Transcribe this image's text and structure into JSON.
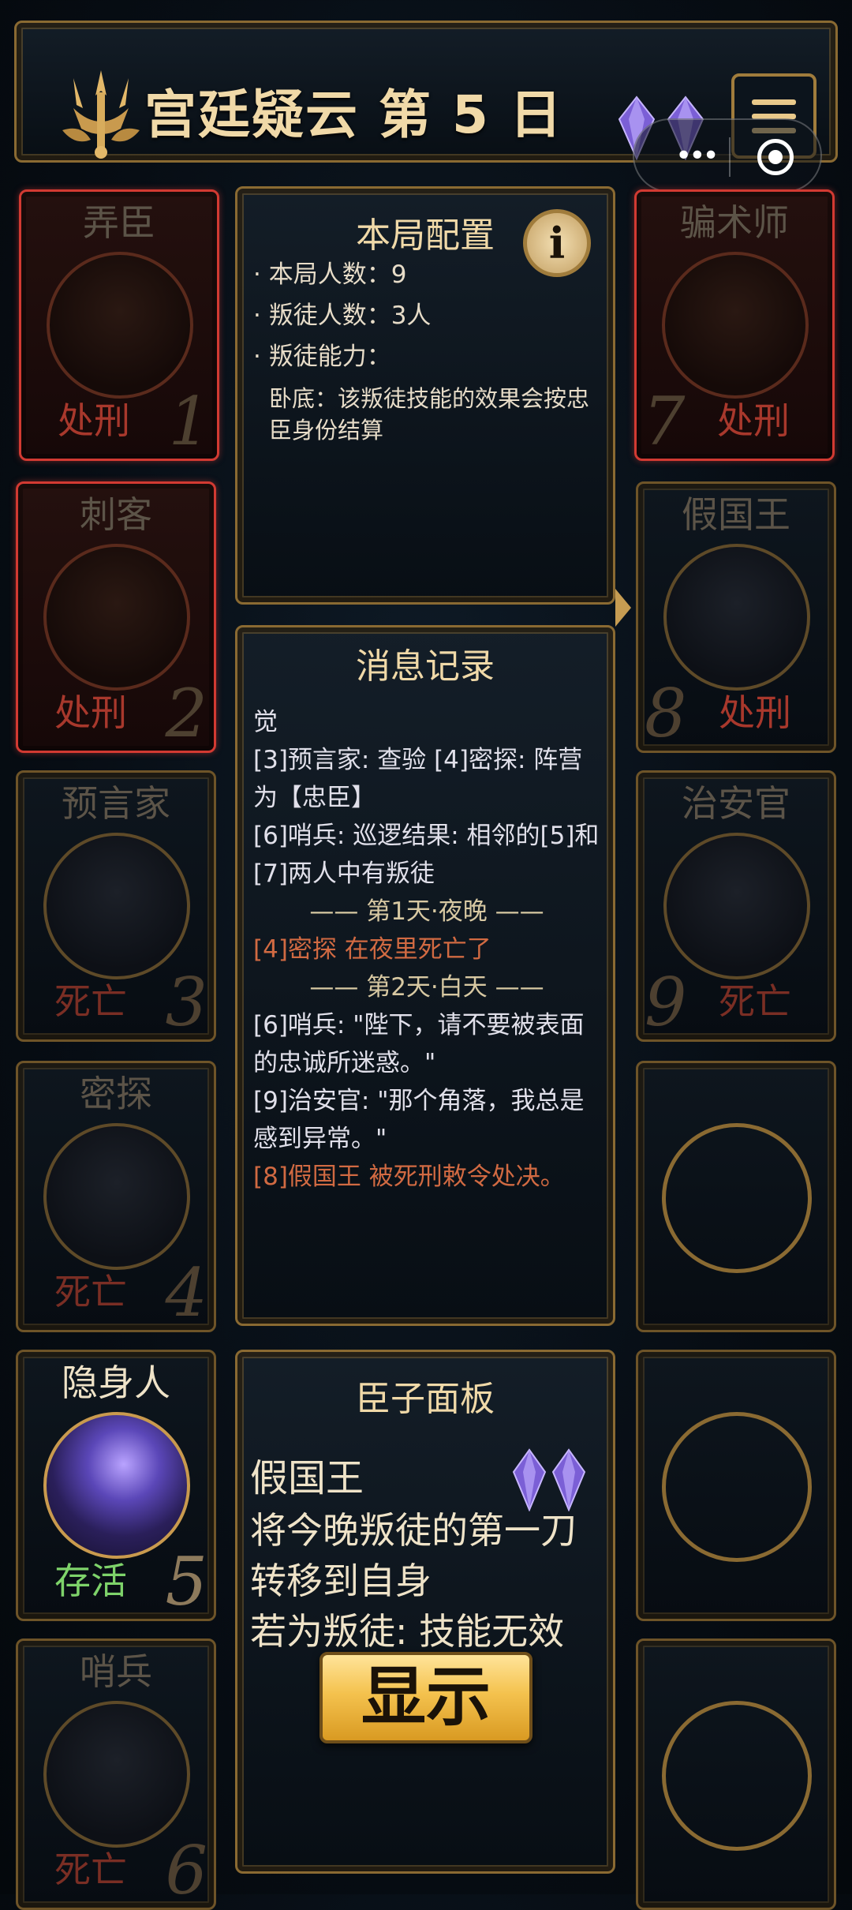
{
  "header": {
    "title": "宫廷疑云 第 5 日",
    "gem_count": 2
  },
  "players": [
    {
      "seat": "1",
      "role": "弄臣",
      "status": "处刑",
      "state": "executed"
    },
    {
      "seat": "2",
      "role": "刺客",
      "status": "处刑",
      "state": "executed"
    },
    {
      "seat": "3",
      "role": "预言家",
      "status": "死亡",
      "state": "dead"
    },
    {
      "seat": "4",
      "role": "密探",
      "status": "死亡",
      "state": "dead"
    },
    {
      "seat": "5",
      "role": "隐身人",
      "status": "存活",
      "state": "alive"
    },
    {
      "seat": "6",
      "role": "哨兵",
      "status": "死亡",
      "state": "dead"
    },
    {
      "seat": "7",
      "role": "骗术师",
      "status": "处刑",
      "state": "executed"
    },
    {
      "seat": "8",
      "role": "假国王",
      "status": "处刑",
      "state": "executed"
    },
    {
      "seat": "9",
      "role": "治安官",
      "status": "死亡",
      "state": "dead"
    }
  ],
  "config": {
    "title": "本局配置",
    "info_icon": "i",
    "players_line": "· 本局人数：9",
    "traitors_line": "· 叛徒人数：3人",
    "ability_line": "· 叛徒能力：",
    "ability_desc": "卧底：该叛徒技能的效果会按忠臣身份结算"
  },
  "log": {
    "title": "消息记录",
    "lines": [
      {
        "text": "觉",
        "style": "normal"
      },
      {
        "text": "[3]预言家: 查验 [4]密探: 阵营为【忠臣】",
        "style": "normal"
      },
      {
        "text": "[6]哨兵: 巡逻结果: 相邻的[5]和[7]两人中有叛徒",
        "style": "normal"
      },
      {
        "text": "—— 第1天·夜晚 ——",
        "style": "sep"
      },
      {
        "text": "[4]密探 在夜里死亡了",
        "style": "red"
      },
      {
        "text": "—— 第2天·白天 ——",
        "style": "sep"
      },
      {
        "text": "[6]哨兵: \"陛下，请不要被表面的忠诚所迷惑。\"",
        "style": "normal"
      },
      {
        "text": "[9]治安官: \"那个角落，我总是感到异常。\"",
        "style": "normal"
      },
      {
        "text": "[8]假国王 被死刑敕令处决。",
        "style": "red"
      }
    ]
  },
  "minister_panel": {
    "title": "臣子面板",
    "role": "假国王",
    "gem_count": 2,
    "desc": "将今晚叛徒的第一刀转移到自身",
    "desc2": "若为叛徒: 技能无效",
    "show_button": "显示"
  },
  "colors": {
    "gold": "#c69c52",
    "executed_red": "#d23a32",
    "alive_green": "#7ed36a",
    "log_red": "#d16a42"
  },
  "icons": {
    "crown": "trident-crown-icon",
    "gem": "purple-gem-icon",
    "menu": "hamburger-menu-icon",
    "info": "info-icon"
  }
}
